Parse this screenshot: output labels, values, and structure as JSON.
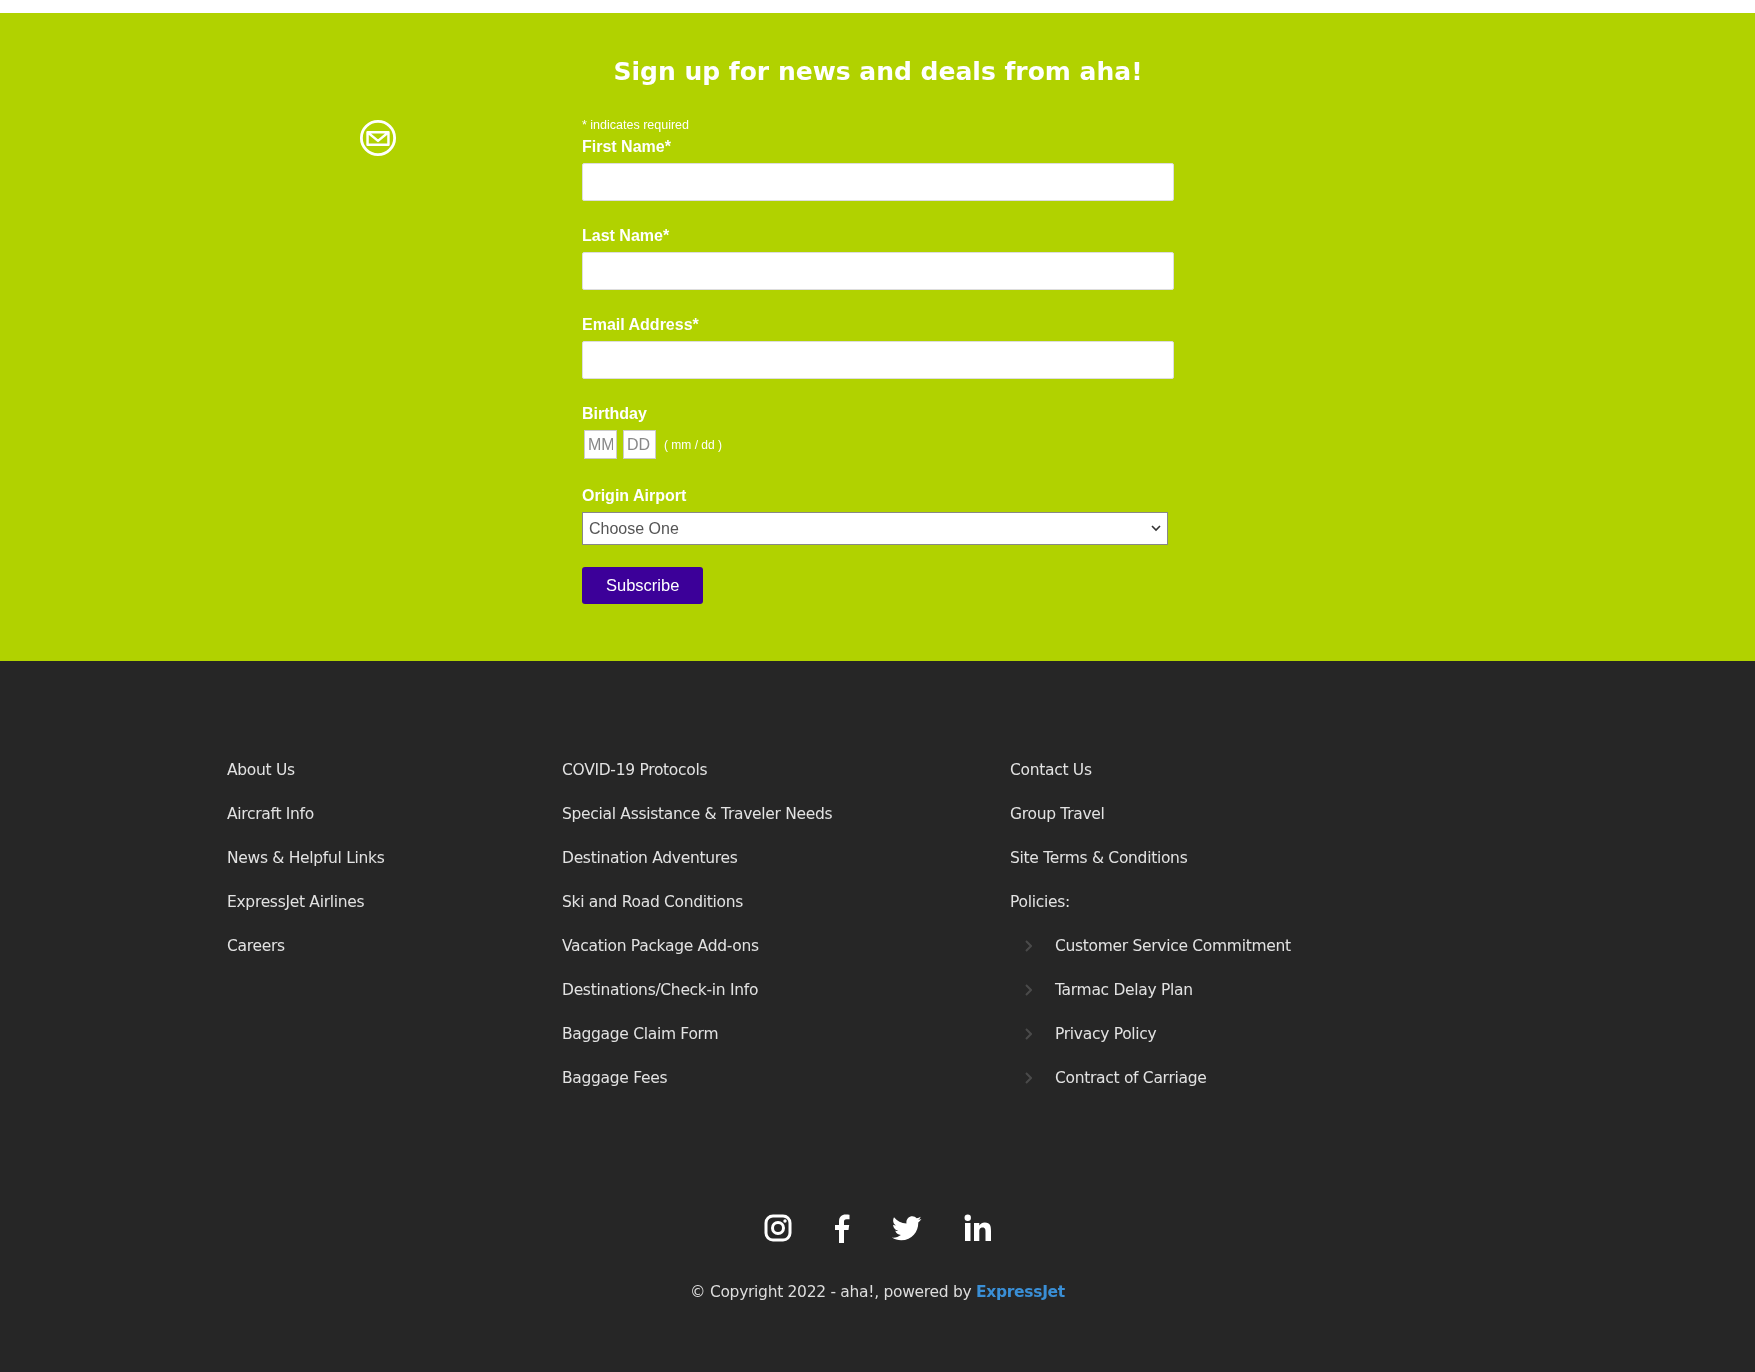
{
  "signup": {
    "title": "Sign up for news and deals from aha!",
    "required_note": "* indicates required",
    "fields": [
      {
        "label": "First Name*",
        "kind": "text"
      },
      {
        "label": "Last Name*",
        "kind": "text"
      },
      {
        "label": "Email Address*",
        "kind": "text"
      },
      {
        "label": "Birthday",
        "kind": "date",
        "parts": [
          {
            "placeholder": "MM"
          },
          {
            "placeholder": "DD"
          }
        ],
        "hint": "( mm / dd )"
      },
      {
        "label": "Origin Airport",
        "kind": "select",
        "value": "Choose One"
      }
    ],
    "button": "Subscribe"
  },
  "footer": {
    "columns": [
      [
        {
          "label": "About Us"
        },
        {
          "label": "Aircraft Info"
        },
        {
          "label": "News & Helpful Links"
        },
        {
          "label": "ExpressJet Airlines"
        },
        {
          "label": "Careers"
        }
      ],
      [
        {
          "label": "COVID-19 Protocols"
        },
        {
          "label": "Special Assistance & Traveler Needs"
        },
        {
          "label": "Destination Adventures"
        },
        {
          "label": "Ski and Road Conditions"
        },
        {
          "label": "Vacation Package Add-ons"
        },
        {
          "label": "Destinations/Check-in Info"
        },
        {
          "label": "Baggage Claim Form"
        },
        {
          "label": "Baggage Fees"
        }
      ],
      [
        {
          "label": "Contact Us"
        },
        {
          "label": "Group Travel"
        },
        {
          "label": "Site Terms & Conditions"
        },
        {
          "label": "Policies:",
          "children": [
            {
              "label": "Customer Service Commitment"
            },
            {
              "label": "Tarmac Delay Plan"
            },
            {
              "label": "Privacy Policy"
            },
            {
              "label": "Contract of Carriage"
            }
          ]
        }
      ]
    ],
    "social": [
      {
        "kind": "instagram"
      },
      {
        "kind": "facebook"
      },
      {
        "kind": "twitter"
      },
      {
        "kind": "linkedin"
      }
    ],
    "copyright": "© Copyright 2022 - aha!, powered by ",
    "copyright_link": "ExpressJet"
  }
}
